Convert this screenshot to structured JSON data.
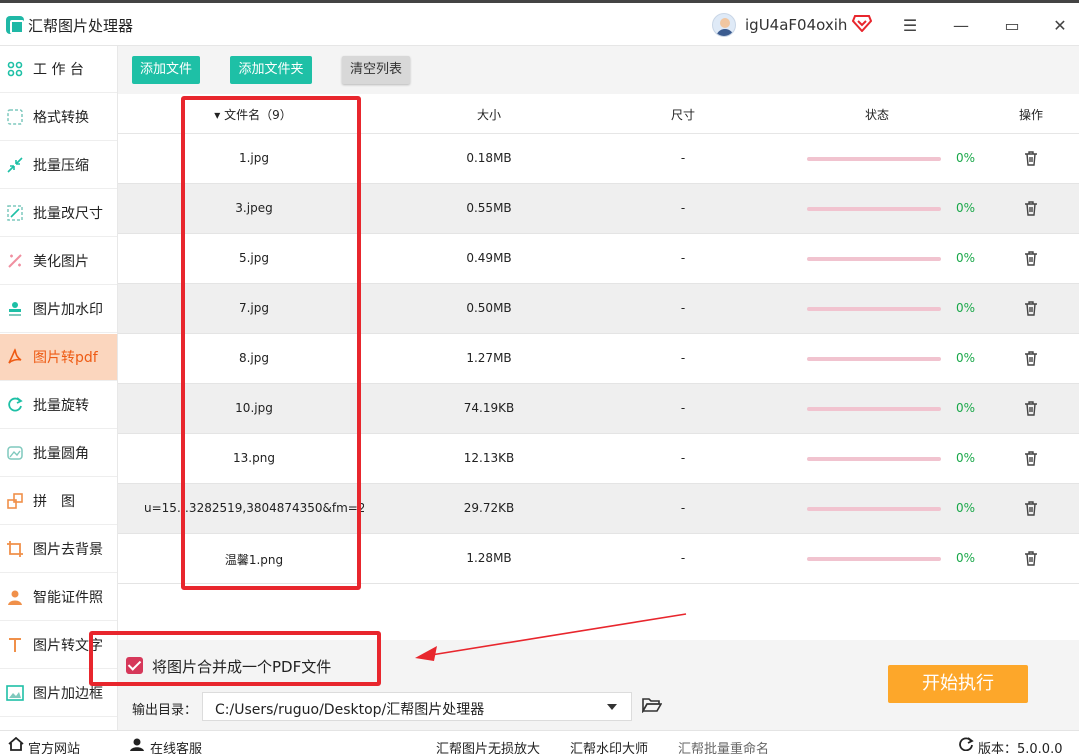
{
  "app": {
    "title": "汇帮图片处理器",
    "username": "igU4aF04oxih"
  },
  "window_controls": {
    "menu": "☰",
    "minimize": "—",
    "maximize": "▭",
    "close": "✕"
  },
  "sidebar": {
    "items": [
      {
        "label": "工 作 台",
        "icon": "workspace-icon"
      },
      {
        "label": "格式转换",
        "icon": "convert-icon"
      },
      {
        "label": "批量压缩",
        "icon": "compress-icon"
      },
      {
        "label": "批量改尺寸",
        "icon": "resize-icon"
      },
      {
        "label": "美化图片",
        "icon": "beautify-icon"
      },
      {
        "label": "图片加水印",
        "icon": "watermark-icon"
      },
      {
        "label": "图片转pdf",
        "icon": "pdf-icon",
        "active": true
      },
      {
        "label": "批量旋转",
        "icon": "rotate-icon"
      },
      {
        "label": "批量圆角",
        "icon": "round-corner-icon"
      },
      {
        "label": "拼　图",
        "icon": "puzzle-icon"
      },
      {
        "label": "图片去背景",
        "icon": "crop-icon"
      },
      {
        "label": "智能证件照",
        "icon": "id-photo-icon"
      },
      {
        "label": "图片转文字",
        "icon": "text-icon"
      },
      {
        "label": "图片加边框",
        "icon": "frame-icon"
      }
    ]
  },
  "toolbar": {
    "add_file": "添加文件",
    "add_folder": "添加文件夹",
    "clear_list": "清空列表"
  },
  "table": {
    "headers": {
      "name": "▾ 文件名（9）",
      "size": "大小",
      "dimensions": "尺寸",
      "status": "状态",
      "action": "操作"
    },
    "rows": [
      {
        "name": "1.jpg",
        "size": "0.18MB",
        "dim": "-",
        "progress": "0%"
      },
      {
        "name": "3.jpeg",
        "size": "0.55MB",
        "dim": "-",
        "progress": "0%"
      },
      {
        "name": "5.jpg",
        "size": "0.49MB",
        "dim": "-",
        "progress": "0%"
      },
      {
        "name": "7.jpg",
        "size": "0.50MB",
        "dim": "-",
        "progress": "0%"
      },
      {
        "name": "8.jpg",
        "size": "1.27MB",
        "dim": "-",
        "progress": "0%"
      },
      {
        "name": "10.jpg",
        "size": "74.19KB",
        "dim": "-",
        "progress": "0%"
      },
      {
        "name": "13.png",
        "size": "12.13KB",
        "dim": "-",
        "progress": "0%"
      },
      {
        "name": "u=15…3282519,3804874350&fm=2…",
        "size": "29.72KB",
        "dim": "-",
        "progress": "0%"
      },
      {
        "name": "温馨1.png",
        "size": "1.28MB",
        "dim": "-",
        "progress": "0%"
      }
    ]
  },
  "bottom": {
    "merge_label": "将图片合并成一个PDF文件",
    "merge_checked": true,
    "output_label": "输出目录：",
    "output_path": "C:/Users/ruguo/Desktop/汇帮图片处理器",
    "start_button": "开始执行"
  },
  "footer": {
    "website": "官方网站",
    "support": "在线客服",
    "link1": "汇帮图片无损放大",
    "link2": "汇帮水印大师",
    "link3": "汇帮批量重命名",
    "version": "版本：5.0.0.0"
  },
  "colors": {
    "accent_teal": "#1ec0a6",
    "active_bg": "#fbd6be",
    "active_text": "#ee5b14",
    "start_orange": "#fda72a",
    "annotation_red": "#e8262d",
    "progress_green": "#1aa84a"
  }
}
